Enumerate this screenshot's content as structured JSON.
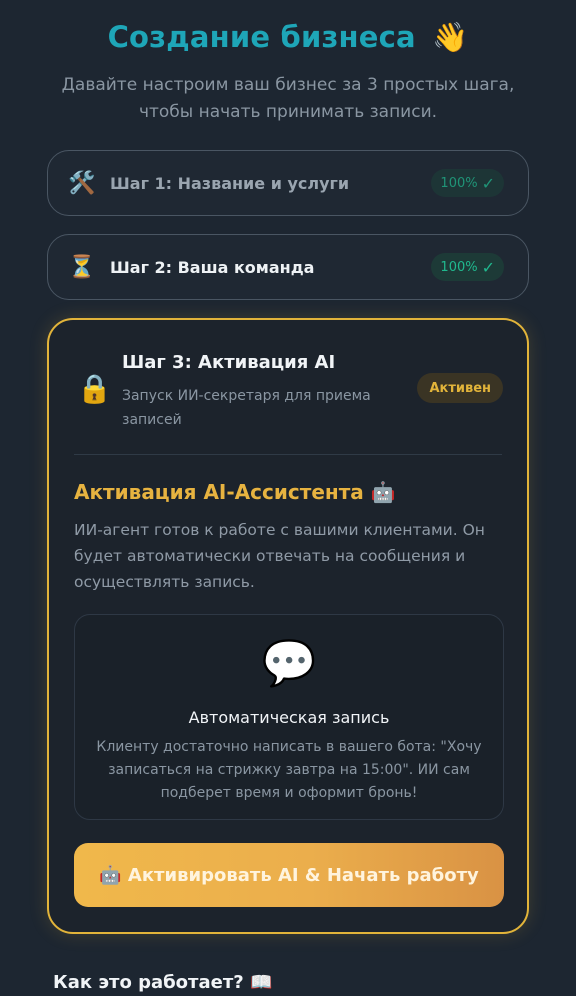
{
  "header": {
    "title": "Создание бизнеса",
    "title_emoji": "👋",
    "subtitle": "Давайте настроим ваш бизнес за 3 простых шага, чтобы начать принимать записи."
  },
  "steps": [
    {
      "icon": "🛠️",
      "icon_name": "tools-icon",
      "label": "Шаг 1: Название и услуги",
      "status": "100%",
      "check": "✓"
    },
    {
      "icon": "⏳",
      "icon_name": "hourglass-icon",
      "label": "Шаг 2: Ваша команда",
      "status": "100%",
      "check": "✓"
    }
  ],
  "active_step": {
    "icon": "🔒",
    "icon_name": "lock-icon",
    "title": "Шаг 3: Активация AI",
    "description": "Запуск ИИ-секретаря для приема записей",
    "badge": "Активен",
    "section_title": "Активация AI-Ассистента 🤖",
    "section_text": "ИИ-агент готов к работе с вашими клиентами. Он будет автоматически отвечать на сообщения и осуществлять запись.",
    "feature": {
      "icon": "💬",
      "icon_name": "speech-bubble-icon",
      "title": "Автоматическая запись",
      "text": "Клиенту достаточно написать в вашего бота: \"Хочу записаться на стрижку завтра на 15:00\". ИИ сам подберет время и оформит бронь!"
    },
    "cta_label": "🤖 Активировать AI & Начать работу"
  },
  "footer": {
    "how_it_works": "Как это работает? 📖"
  },
  "colors": {
    "accent_teal": "#1ea6b8",
    "accent_gold": "#e2b43a",
    "success_green": "#20b88e",
    "background": "#1d2631"
  }
}
